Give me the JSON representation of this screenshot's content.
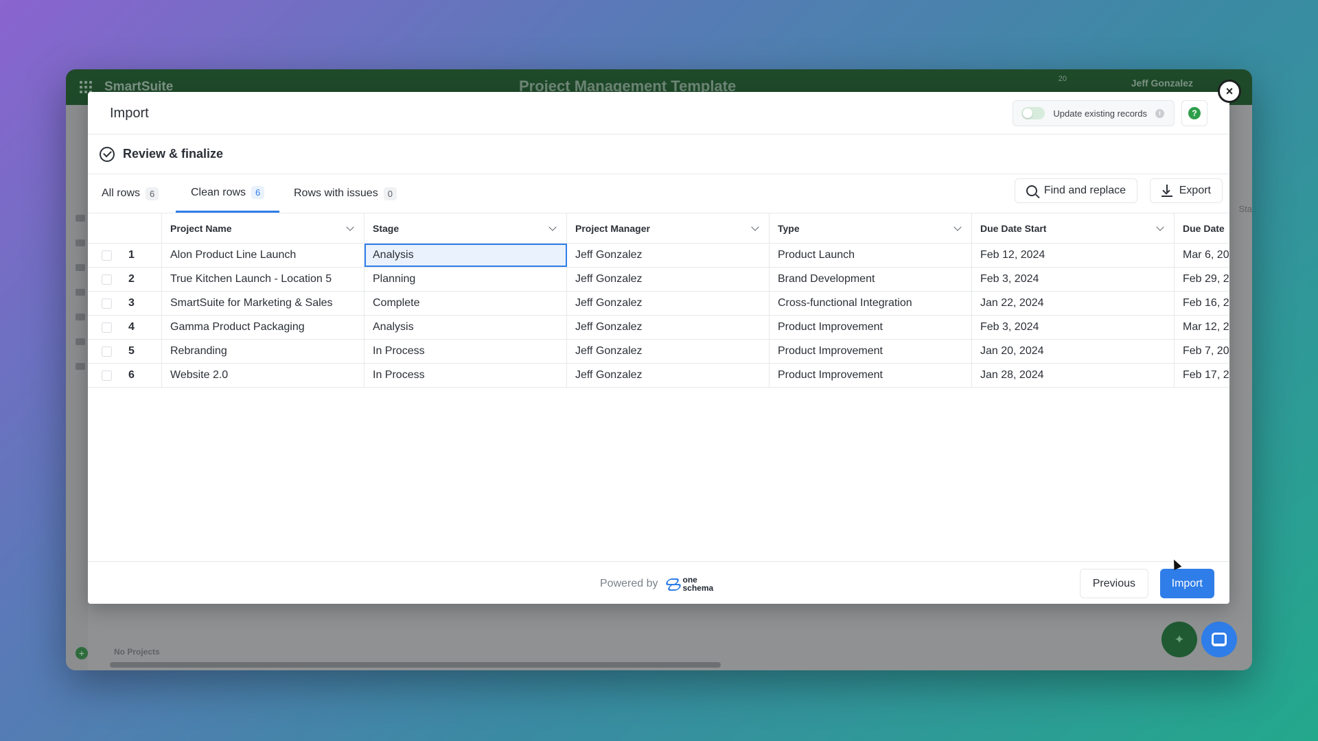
{
  "app": {
    "brand": "SmartSuite",
    "workspace_title": "Project Management Template",
    "user_name": "Jeff Gonzalez",
    "notification_count": "20",
    "bottom_text": "No Projects",
    "side_text": "Sta"
  },
  "modal": {
    "title": "Import",
    "update_existing_label": "Update existing records",
    "update_existing_on": false,
    "help_label": "?",
    "close_label": "×",
    "section_title": "Review & finalize"
  },
  "tabs": [
    {
      "label": "All rows",
      "count": "6"
    },
    {
      "label": "Clean rows",
      "count": "6"
    },
    {
      "label": "Rows with issues",
      "count": "0"
    }
  ],
  "toolbar": {
    "find_replace_label": "Find and replace",
    "export_label": "Export"
  },
  "table": {
    "columns": [
      "Project Name",
      "Stage",
      "Project Manager",
      "Type",
      "Due Date Start",
      "Due Date"
    ],
    "rows": [
      {
        "num": "1",
        "name": "Alon Product Line Launch",
        "stage": "Analysis",
        "manager": "Jeff Gonzalez",
        "type": "Product Launch",
        "start": "Feb 12, 2024",
        "due": "Mar 6, 20"
      },
      {
        "num": "2",
        "name": "True Kitchen Launch - Location 5",
        "stage": "Planning",
        "manager": "Jeff Gonzalez",
        "type": "Brand Development",
        "start": "Feb 3, 2024",
        "due": "Feb 29, 2"
      },
      {
        "num": "3",
        "name": "SmartSuite for Marketing & Sales",
        "stage": "Complete",
        "manager": "Jeff Gonzalez",
        "type": "Cross-functional Integration",
        "start": "Jan 22, 2024",
        "due": "Feb 16, 2"
      },
      {
        "num": "4",
        "name": "Gamma Product Packaging",
        "stage": "Analysis",
        "manager": "Jeff Gonzalez",
        "type": "Product Improvement",
        "start": "Feb 3, 2024",
        "due": "Mar 12, 2"
      },
      {
        "num": "5",
        "name": "Rebranding",
        "stage": "In Process",
        "manager": "Jeff Gonzalez",
        "type": "Product Improvement",
        "start": "Jan 20, 2024",
        "due": "Feb 7, 20"
      },
      {
        "num": "6",
        "name": "Website 2.0",
        "stage": "In Process",
        "manager": "Jeff Gonzalez",
        "type": "Product Improvement",
        "start": "Jan 28, 2024",
        "due": "Feb 17, 2"
      }
    ]
  },
  "footer": {
    "powered_by": "Powered by",
    "logo_line1": "one",
    "logo_line2": "schema",
    "previous_label": "Previous",
    "import_label": "Import"
  },
  "colors": {
    "accent": "#2f7de8",
    "header_green": "#1f4a2a",
    "help_green": "#2e9e4a"
  },
  "icons": [
    "grid-icon",
    "check-circle-icon",
    "search-icon",
    "download-icon",
    "chevron-down-icon",
    "info-icon",
    "help-icon",
    "close-icon",
    "onschema-logo-icon",
    "chat-icon",
    "sparkle-icon"
  ]
}
